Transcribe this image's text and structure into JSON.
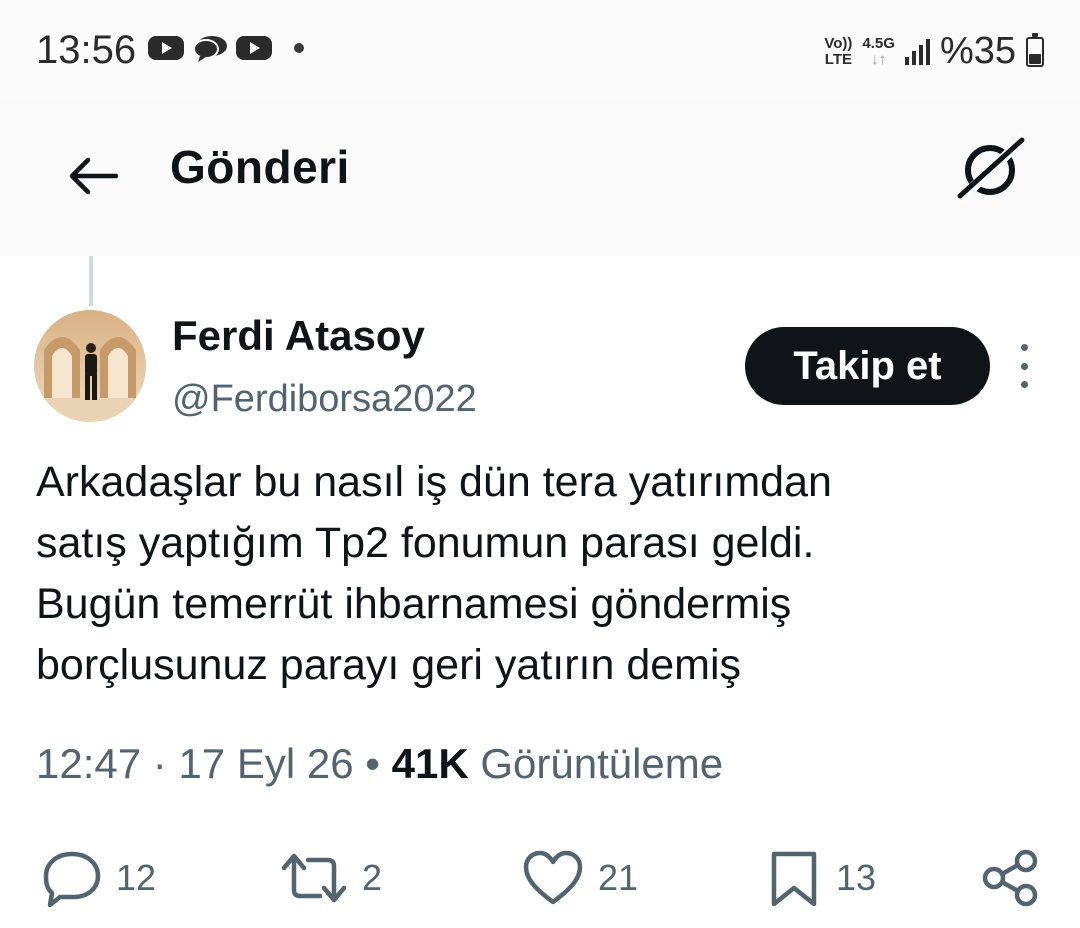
{
  "status_bar": {
    "time": "13:56",
    "app_icons": [
      "youtube-icon",
      "chat-icon",
      "youtube-icon"
    ],
    "volte_line1": "Vo))",
    "volte_line2": "LTE",
    "net_line1": "4.5G",
    "net_line2": "↓↑",
    "battery_text": "%35",
    "battery_level_percent": 35
  },
  "header": {
    "title": "Gönderi",
    "back_icon": "arrow-left-icon",
    "grok_icon": "grok-icon"
  },
  "author": {
    "name": "Ferdi Atasoy",
    "handle": "@Ferdiborsa2022",
    "follow_label": "Takip et"
  },
  "tweet": {
    "text": "Arkadaşlar bu nasıl iş dün tera yatırımdan\nsatış yaptığım Tp2 fonumun parası geldi.\nBugün temerrüt ihbarnamesi göndermiş\nborçlusunuz parayı geri yatırın demiş",
    "time": "12:47",
    "sep1": " · ",
    "date": "17 Eyl 26",
    "sep2": " • ",
    "views_count": "41K",
    "views_label": " Görüntüleme"
  },
  "actions": {
    "replies": "12",
    "retweets": "2",
    "likes": "21",
    "bookmarks": "13"
  },
  "colors": {
    "text_primary": "#0f1419",
    "text_secondary": "#536471",
    "button_dark": "#0f1419",
    "thread_line": "#cfd9de"
  }
}
